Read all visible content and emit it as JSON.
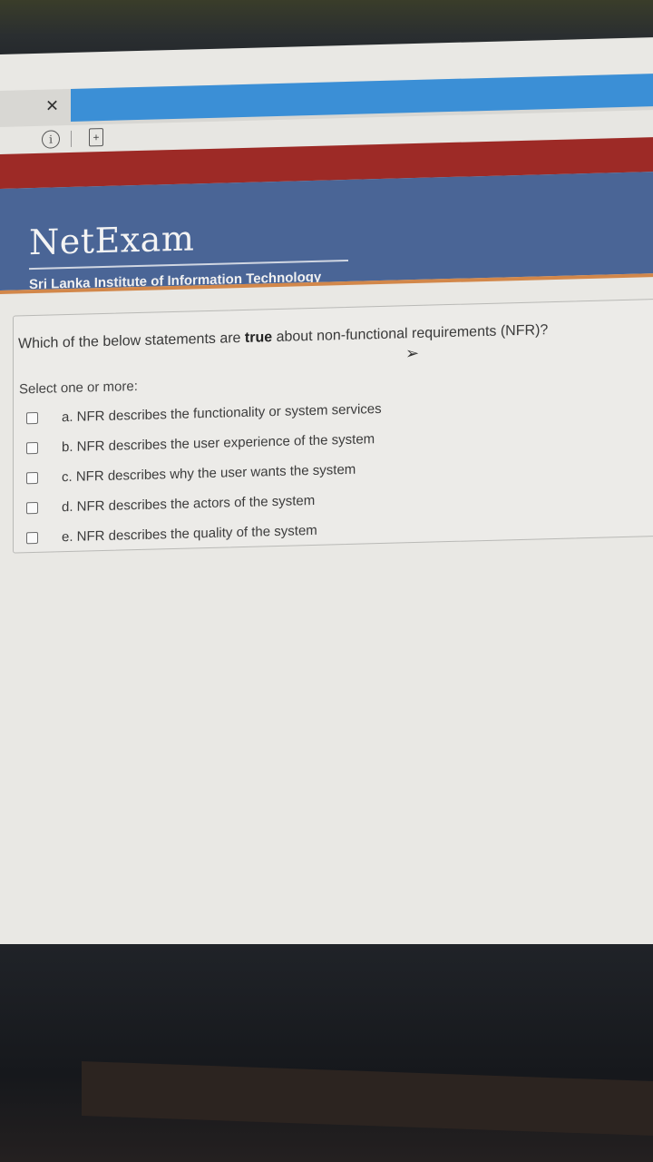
{
  "browser": {
    "close_glyph": "✕",
    "info_glyph": "i",
    "page_glyph": "+"
  },
  "header": {
    "logo": "NetExam",
    "institute": "Sri Lanka Institute of Information Technology"
  },
  "question": {
    "text_before": "Which of the below statements are ",
    "text_emphasis": "true",
    "text_after": " about non-functional requirements (NFR)?",
    "select_label": "Select one or more:",
    "options": [
      {
        "label": "a. NFR describes the functionality or system services",
        "checked": false
      },
      {
        "label": "b. NFR describes the user experience of the system",
        "checked": false
      },
      {
        "label": "c. NFR describes why the user wants the system",
        "checked": false
      },
      {
        "label": "d. NFR describes the actors of the system",
        "checked": false
      },
      {
        "label": "e. NFR describes the quality of the system",
        "checked": false
      }
    ]
  },
  "colors": {
    "header_bg": "#4a6596",
    "red_band": "#9d2a26",
    "accent_line": "#d2874a",
    "tab_active": "#3b8fd6"
  }
}
